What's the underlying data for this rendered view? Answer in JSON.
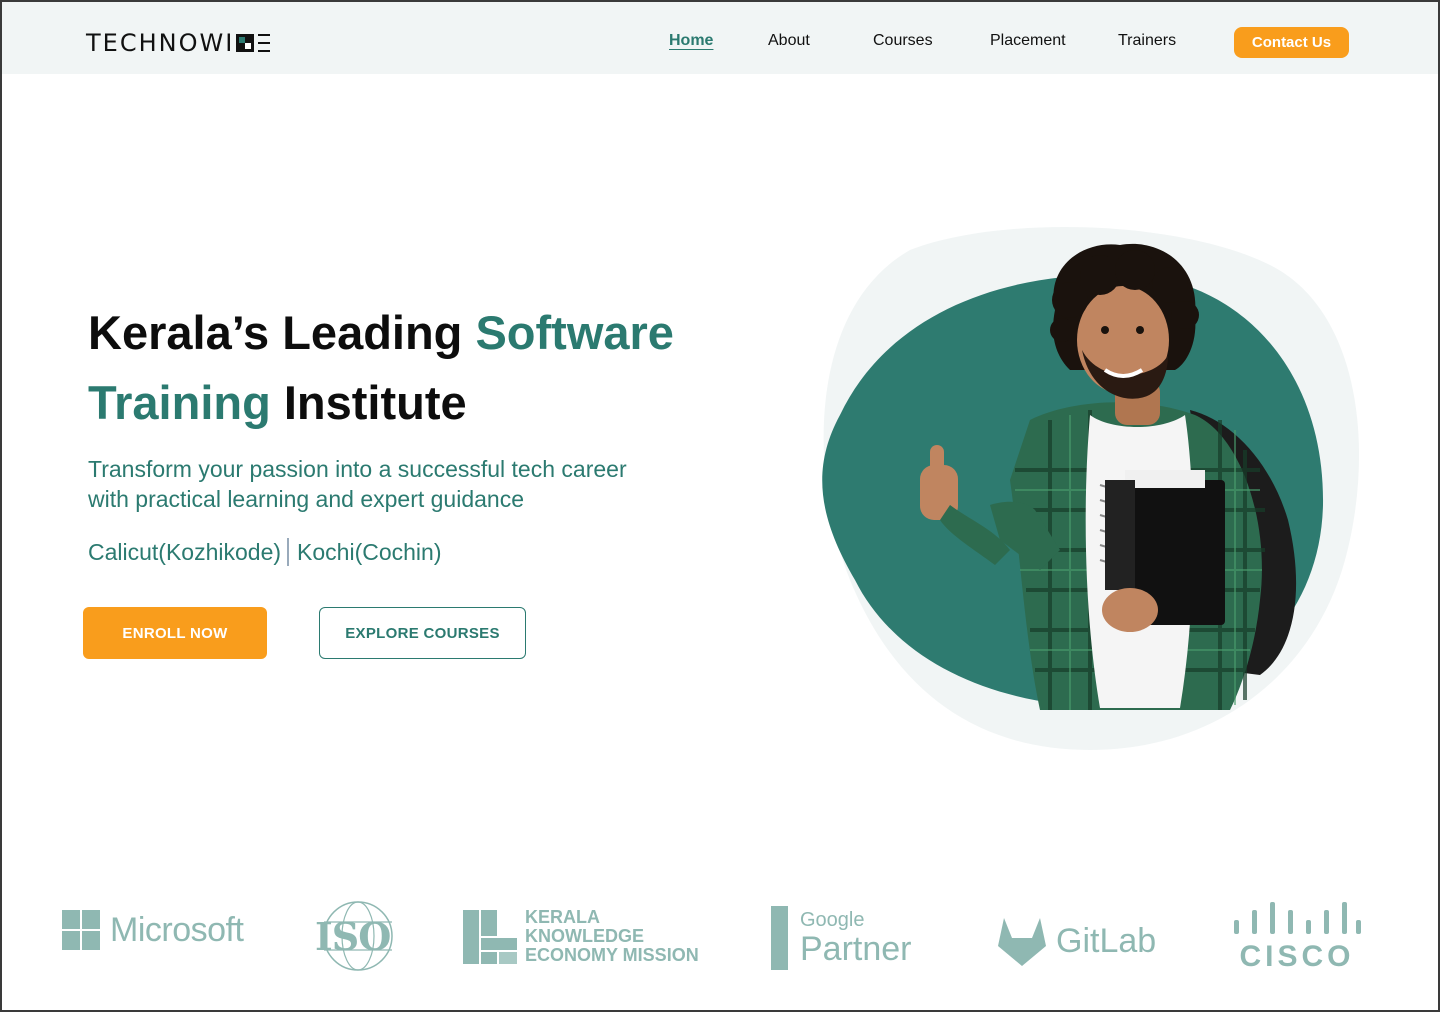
{
  "nav": {
    "logo": "TECHNOWISE",
    "links": [
      {
        "label": "Home",
        "active": true
      },
      {
        "label": "About"
      },
      {
        "label": "Courses"
      },
      {
        "label": "Placement"
      },
      {
        "label": "Trainers"
      }
    ],
    "contact_label": "Contact Us"
  },
  "hero": {
    "headline_part1": "Kerala’s Leading ",
    "headline_accent1": "Software",
    "headline_accent2": "Training",
    "headline_part2": " Institute",
    "subtitle_line1": "Transform your passion into a successful tech career",
    "subtitle_line2": "with practical learning and expert guidance",
    "location1": "Calicut(Kozhikode)",
    "location2": "Kochi(Cochin)",
    "enroll_label": "ENROLL NOW",
    "explore_label": "EXPLORE COURSES"
  },
  "partners": {
    "microsoft": "Microsoft",
    "iso": "ISO",
    "kkem_line1": "KERALA",
    "kkem_line2": "KNOWLEDGE",
    "kkem_line3": "ECONOMY MISSION",
    "google_small": "Google",
    "google_big": "Partner",
    "gitlab": "GitLab",
    "cisco": "CISCO"
  },
  "colors": {
    "accent_teal": "#2b7a70",
    "accent_orange": "#f99d1c",
    "logo_muted": "#8fb8b2",
    "nav_bg": "#f1f5f5"
  }
}
